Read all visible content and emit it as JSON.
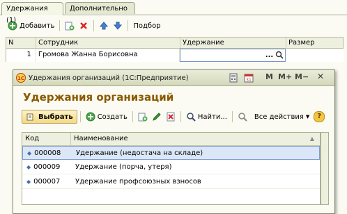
{
  "tabs": [
    {
      "label": "Удержания (1)"
    },
    {
      "label": "Дополнительно"
    }
  ],
  "toolbar": {
    "add_label": "Добавить",
    "pick_label": "Подбор"
  },
  "grid": {
    "columns": [
      "N",
      "Сотрудник",
      "Удержание",
      "Размер"
    ],
    "rows": [
      {
        "n": "1",
        "employee": "Громова Жанна Борисовна",
        "deduction": "",
        "size": ""
      }
    ],
    "ellipsis": "...",
    "search_glyph": "🔍"
  },
  "modal": {
    "title": "Удержания организаций  (1С:Предприятие)",
    "heading": "Удержания организаций",
    "title_buttons": {
      "m": "M",
      "mplus": "M+",
      "mminus": "M−"
    },
    "toolbar": {
      "select_label": "Выбрать",
      "create_label": "Создать",
      "find_label": "Найти...",
      "all_actions_label": "Все действия",
      "help_label": "?"
    },
    "list": {
      "columns": [
        "Код",
        "Наименование"
      ],
      "rows": [
        {
          "code": "000008",
          "name": "Удержание (недостача на складе)",
          "selected": true
        },
        {
          "code": "000009",
          "name": "Удержание (порча, утеря)",
          "selected": false
        },
        {
          "code": "000007",
          "name": "Удержание профсоюзных взносов",
          "selected": false
        }
      ]
    }
  },
  "colors": {
    "accent": "#8a5a00",
    "selection": "#dbe6f7"
  }
}
